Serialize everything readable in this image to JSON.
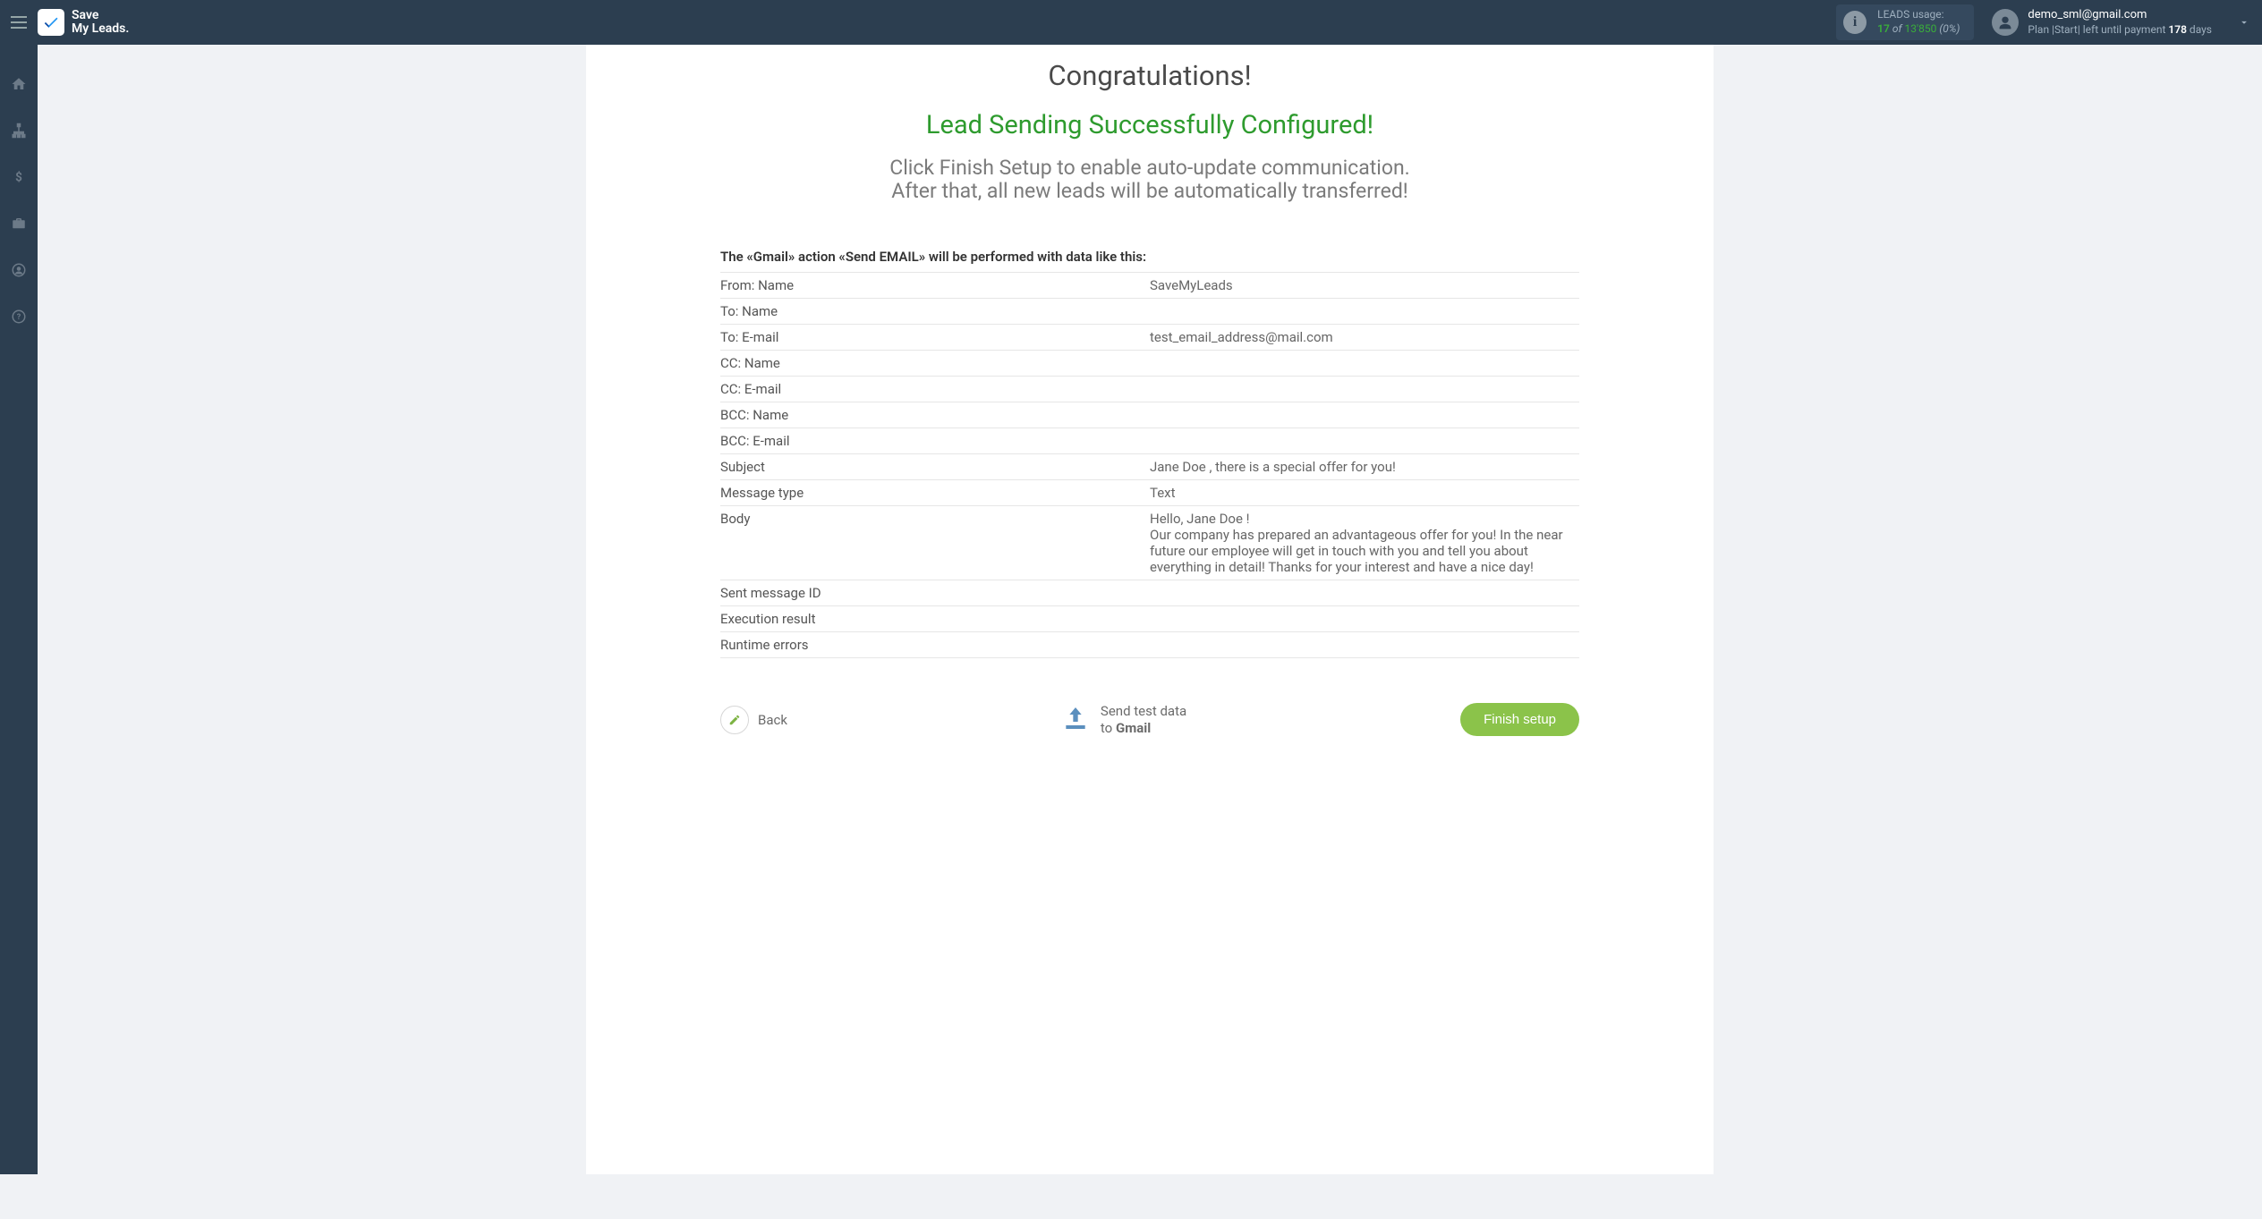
{
  "header": {
    "logo_line1": "Save",
    "logo_line2": "My Leads.",
    "leads_usage": {
      "label": "LEADS usage:",
      "used": "17",
      "of": "of",
      "total": "13'850",
      "percent": "(0%)"
    },
    "user": {
      "email": "demo_sml@gmail.com",
      "plan_prefix": "Plan |Start| left until payment",
      "days": "178",
      "days_suffix": "days"
    }
  },
  "content": {
    "headline": "Congratulations!",
    "subhead": "Lead Sending Successfully Configured!",
    "desc_line1": "Click Finish Setup to enable auto-update communication.",
    "desc_line2": "After that, all new leads will be automatically transferred!",
    "caption": "The «Gmail» action «Send EMAIL» will be performed with data like this:",
    "rows": [
      {
        "key": "From: Name",
        "val": "SaveMyLeads"
      },
      {
        "key": "To: Name",
        "val": ""
      },
      {
        "key": "To: E-mail",
        "val": "test_email_address@mail.com"
      },
      {
        "key": "CC: Name",
        "val": ""
      },
      {
        "key": "CC: E-mail",
        "val": ""
      },
      {
        "key": "BCC: Name",
        "val": ""
      },
      {
        "key": "BCC: E-mail",
        "val": ""
      },
      {
        "key": "Subject",
        "val": "Jane Doe , there is a special offer for you!"
      },
      {
        "key": "Message type",
        "val": "Text"
      },
      {
        "key": "Body",
        "val": "Hello, Jane Doe !\nOur company has prepared an advantageous offer for you! In the near future our employee will get in touch with you and tell you about everything in detail! Thanks for your interest and have a nice day!"
      },
      {
        "key": "Sent message ID",
        "val": ""
      },
      {
        "key": "Execution result",
        "val": ""
      },
      {
        "key": "Runtime errors",
        "val": ""
      }
    ]
  },
  "footer": {
    "back": "Back",
    "send_test_line1": "Send test data",
    "send_test_to": "to",
    "send_test_dest": "Gmail",
    "finish": "Finish setup"
  }
}
